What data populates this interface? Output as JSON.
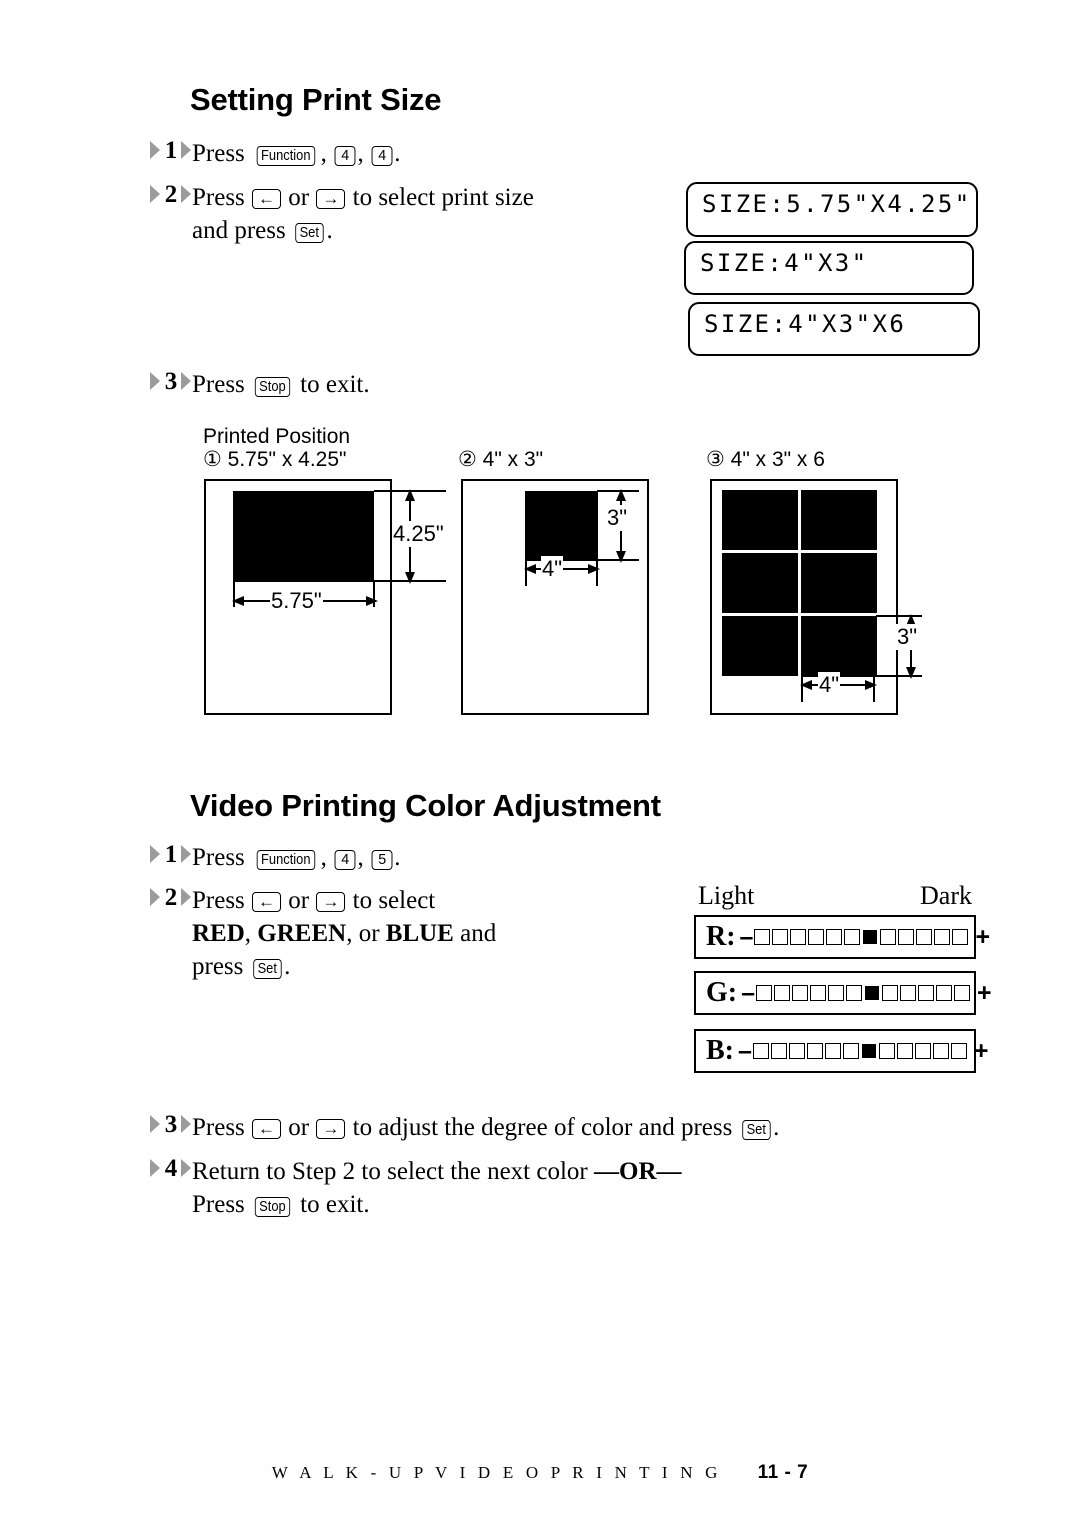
{
  "sections": [
    {
      "heading": "Setting Print Size",
      "steps": [
        {
          "number": "1",
          "line1_pre": "Press ",
          "keys": [
            "Function",
            "4",
            "4"
          ],
          "line1_post": "."
        },
        {
          "number": "2",
          "line1": "Press ",
          "line1b": " or ",
          "line1c": " to select print size",
          "line2a": "and press ",
          "line2b": "."
        },
        {
          "number": "3",
          "text_pre": "Press ",
          "key": "Stop",
          "text_post": " to exit."
        }
      ]
    },
    {
      "heading": "Video Printing Color Adjustment",
      "steps": [
        {
          "number": "1",
          "line1_pre": "Press ",
          "keys": [
            "Function",
            "4",
            "5"
          ],
          "line1_post": "."
        },
        {
          "number": "2",
          "line1": "Press ",
          "line1b": " or ",
          "line1c": " to select",
          "line2": "RED, GREEN, or BLUE and",
          "line2_red": "RED",
          "line2_green": "GREEN",
          "line2_blue": "BLUE",
          "line2_sep1": ", ",
          "line2_sep2": ", or ",
          "line2_tail": " and",
          "line3a": "press ",
          "line3b": "."
        },
        {
          "number": "3",
          "text_pre": "Press ",
          "text_mid": " or ",
          "text_post": " to adjust the degree of color and press ",
          "text_end": "."
        },
        {
          "number": "4",
          "line1": "Return to Step 2 to select the next color ",
          "line1_or": "—OR—",
          "line2a": "Press ",
          "line2b": " to exit."
        }
      ]
    }
  ],
  "keys": {
    "function": "Function",
    "four": "4",
    "five": "5",
    "set": "Set",
    "stop": "Stop",
    "left_arrow": "←",
    "right_arrow": "→"
  },
  "lcd_print_size": [
    {
      "text": "SIZE:5.75\"X4.25\""
    },
    {
      "text": "SIZE:4\"X3\""
    },
    {
      "text": "SIZE:4\"X3\"X6"
    }
  ],
  "printed_position": {
    "title": "Printed Position",
    "diagrams": [
      {
        "caption": "① 5.75\" x 4.25\"",
        "width_label": "5.75\"",
        "height_label": "4.25\""
      },
      {
        "caption": "② 4\" x 3\"",
        "width_label": "4\"",
        "height_label": "3\""
      },
      {
        "caption": "③ 4\" x 3\" x 6",
        "width_label": "4\"",
        "height_label": "3\""
      }
    ]
  },
  "color_scale": {
    "light_label": "Light",
    "dark_label": "Dark",
    "rows": [
      {
        "label": "R:",
        "minus": "–",
        "plus": "+",
        "cells": 12,
        "filled_index": 6
      },
      {
        "label": "G:",
        "minus": "–",
        "plus": "+",
        "cells": 12,
        "filled_index": 6
      },
      {
        "label": "B:",
        "minus": "–",
        "plus": "+",
        "cells": 12,
        "filled_index": 6
      }
    ]
  },
  "footer": {
    "title": "W A L K - U P   V I D E O   P R I N T I N G",
    "page": "11 - 7"
  }
}
